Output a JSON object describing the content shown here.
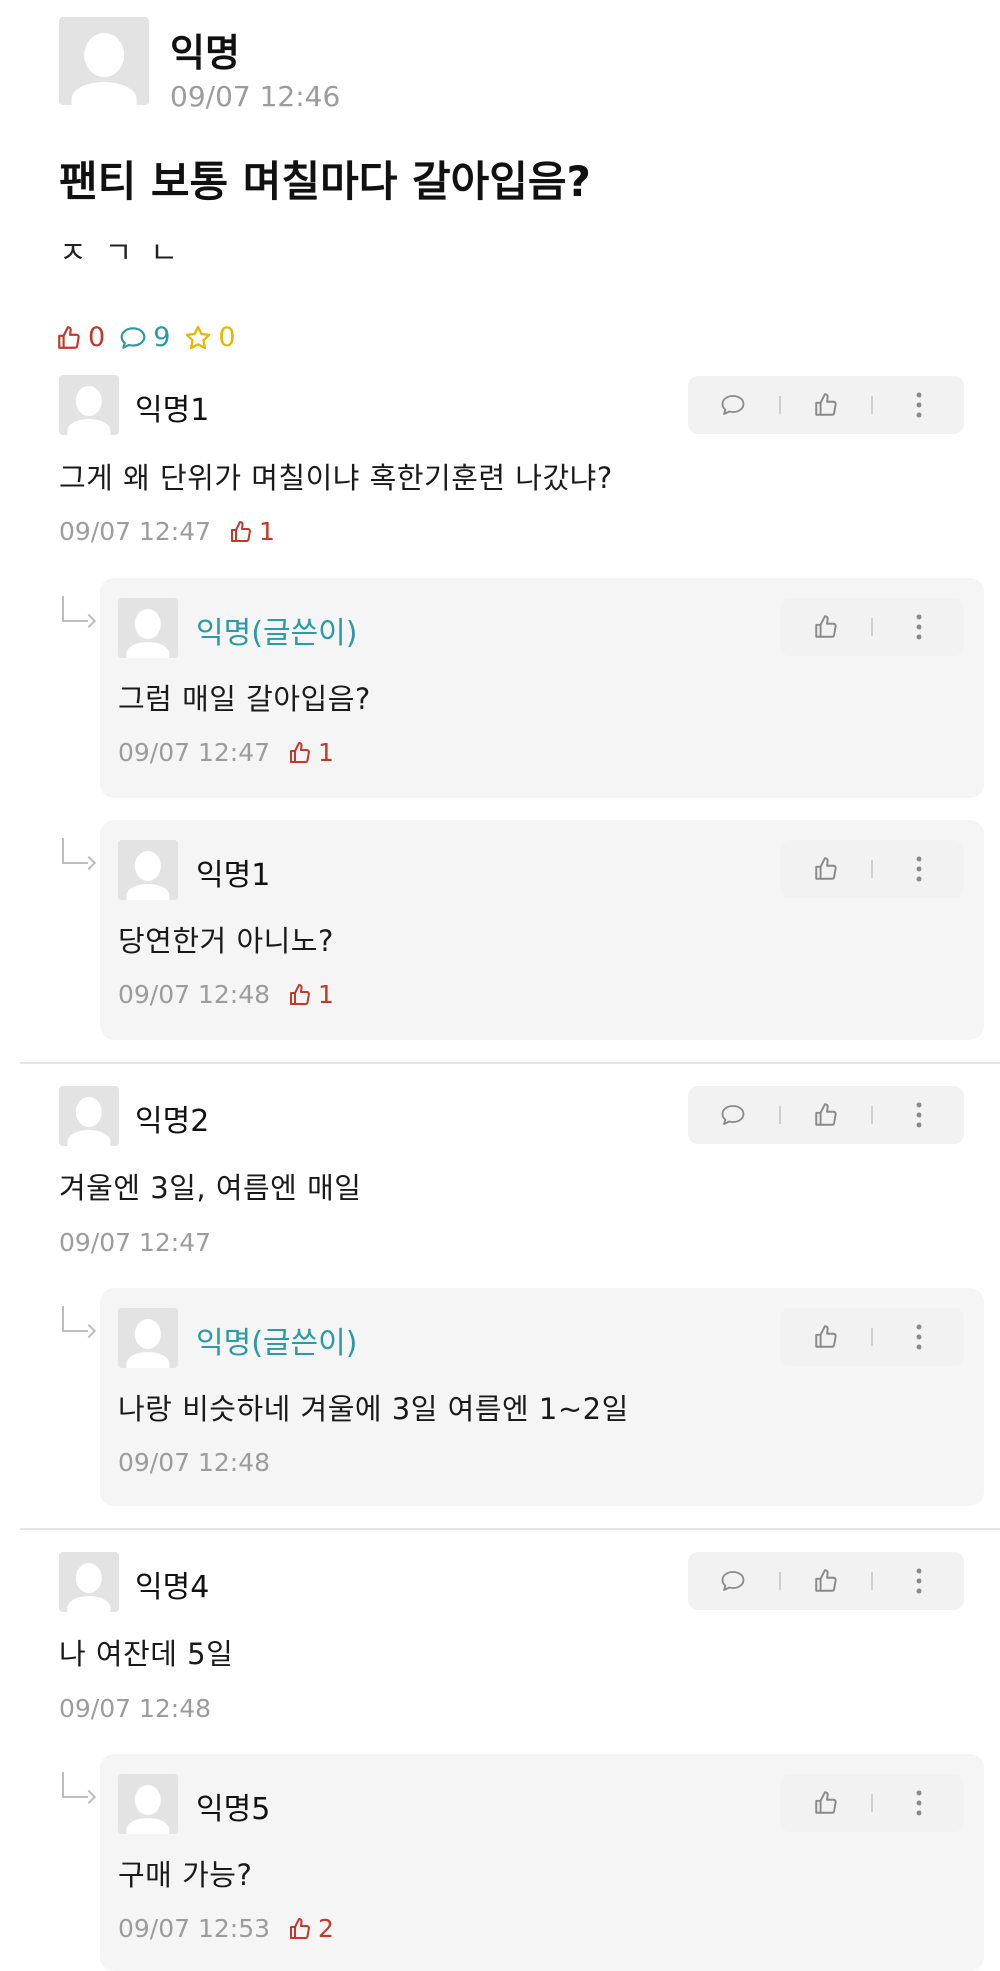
{
  "post": {
    "author": "익명",
    "time": "09/07 12:46",
    "title": "팬티 보통 며칠마다 갈아입음?",
    "body": "ㅈㄱㄴ",
    "likes": "0",
    "comments": "9",
    "scraps": "0"
  },
  "comments": [
    {
      "author": "익명1",
      "text": "그게 왜 단위가 며칠이냐 혹한기훈련 나갔냐?",
      "time": "09/07 12:47",
      "likes": "1",
      "replies": [
        {
          "author": "익명(글쓴이)",
          "text": "그럼 매일 갈아입음?",
          "time": "09/07 12:47",
          "likes": "1"
        },
        {
          "author": "익명1",
          "text": "당연한거 아니노?",
          "time": "09/07 12:48",
          "likes": "1"
        }
      ]
    },
    {
      "author": "익명2",
      "text": "겨울엔 3일, 여름엔 매일",
      "time": "09/07 12:47",
      "replies": [
        {
          "author": "익명(글쓴이)",
          "text": "나랑 비슷하네 겨울에 3일 여름엔 1~2일",
          "time": "09/07 12:48"
        }
      ]
    },
    {
      "author": "익명4",
      "text": "나 여잔데 5일",
      "time": "09/07 12:48",
      "replies": [
        {
          "author": "익명5",
          "text": "구매 가능?",
          "time": "09/07 12:53",
          "likes": "2"
        }
      ]
    }
  ],
  "colors": {
    "like": "#c0392b",
    "comment": "#2a9aa6",
    "scrap": "#e6b800",
    "op_author": "#2a9aa6"
  }
}
